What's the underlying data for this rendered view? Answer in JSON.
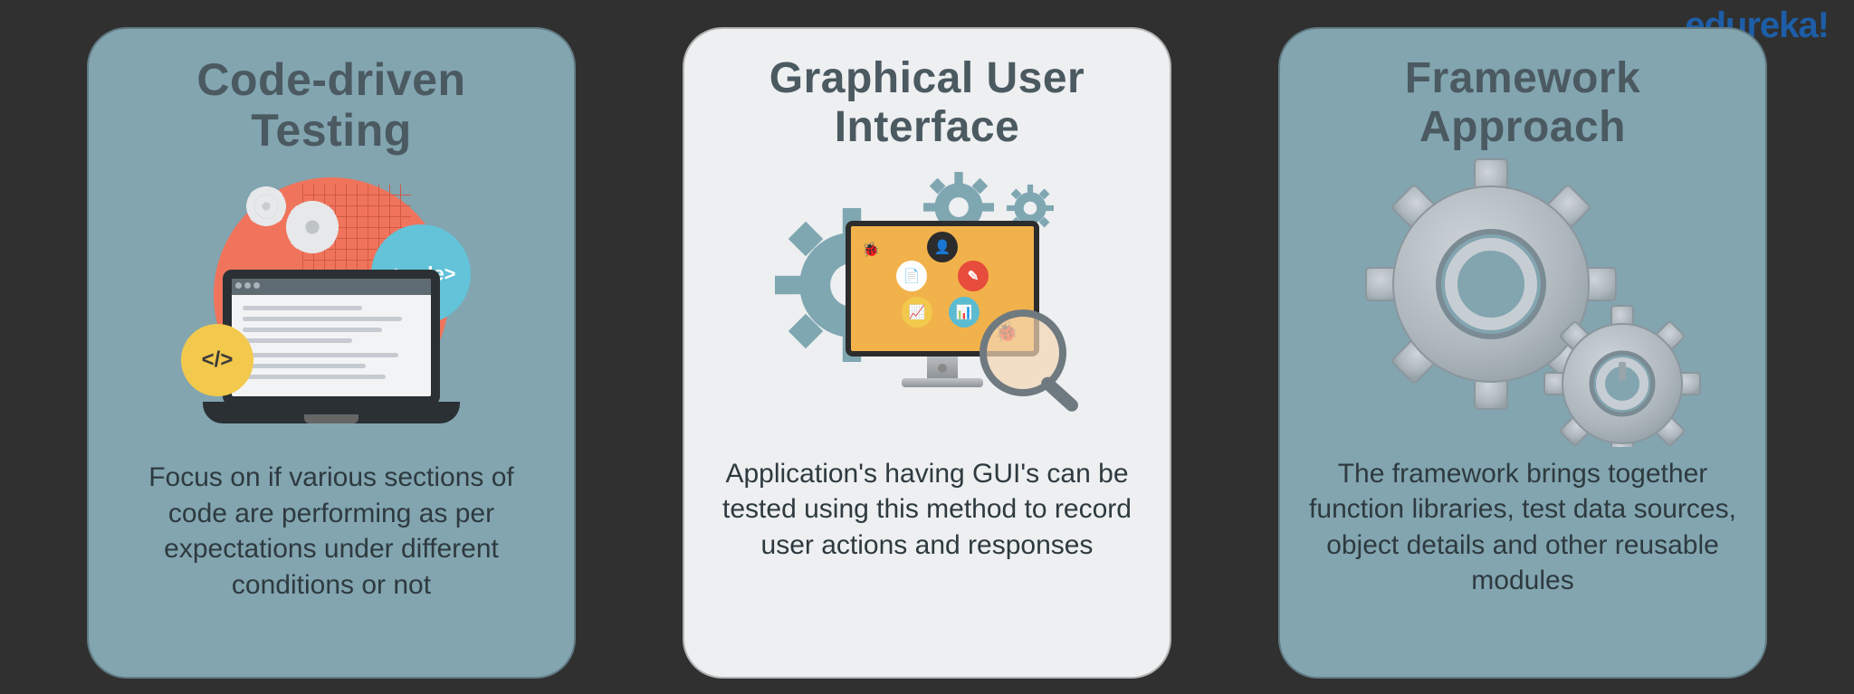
{
  "brand": "edureka!",
  "cards": [
    {
      "id": "code-driven",
      "title": "Code-driven Testing",
      "description": "Focus on if various sections of code are performing as per expectations under different conditions or not",
      "icons": {
        "code_bubble_label": "<code>",
        "tag_bubble_label": "</>"
      }
    },
    {
      "id": "gui",
      "title": "Graphical User Interface",
      "description": "Application's having GUI's can be tested using this method to record user actions and responses"
    },
    {
      "id": "framework",
      "title": "Framework Approach",
      "description": "The framework brings together function libraries, test data sources, object details and other reusable modules"
    }
  ],
  "colors": {
    "card_dark": "#82a5b0",
    "card_light": "#edeff0",
    "accent_orange": "#f0745b",
    "accent_blue": "#62c3d9",
    "accent_yellow": "#f2c94c",
    "brand_blue": "#1d5ea8",
    "title_grey": "#4b5961"
  }
}
